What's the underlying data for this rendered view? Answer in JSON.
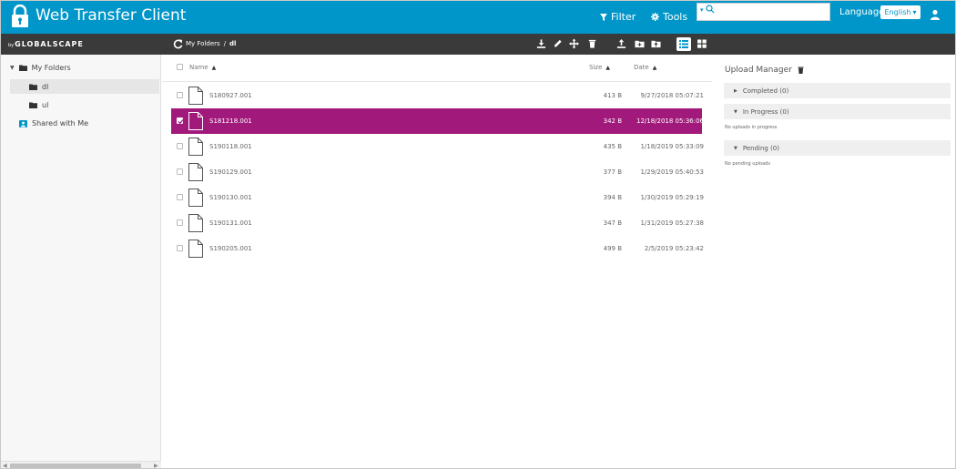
{
  "header": {
    "title": "Web Transfer Client",
    "filter_label": "Filter",
    "tools_label": "Tools",
    "search_placeholder": "",
    "language_label": "Language:",
    "language_value": "English"
  },
  "toolbar": {
    "brand_by": "by",
    "brand": "GLOBALSCAPE",
    "breadcrumb": [
      "My Folders",
      "/",
      "dl"
    ]
  },
  "sidebar": {
    "items": [
      {
        "label": "My Folders",
        "icon": "folder-icon",
        "expanded": true
      },
      {
        "label": "dl",
        "icon": "folder-icon",
        "selected": true
      },
      {
        "label": "ul",
        "icon": "folder-icon"
      },
      {
        "label": "Shared with Me",
        "icon": "shared-icon"
      }
    ]
  },
  "files": {
    "columns": {
      "name": "Name",
      "size": "Size",
      "date": "Date"
    },
    "rows": [
      {
        "name": "S180927.001",
        "size": "413 B",
        "date": "9/27/2018 05:07:21",
        "selected": false
      },
      {
        "name": "S181218.001",
        "size": "342 B",
        "date": "12/18/2018 05:36:06",
        "selected": true
      },
      {
        "name": "S190118.001",
        "size": "435 B",
        "date": "1/18/2019 05:33:09",
        "selected": false
      },
      {
        "name": "S190129.001",
        "size": "377 B",
        "date": "1/29/2019 05:40:53",
        "selected": false
      },
      {
        "name": "S190130.001",
        "size": "394 B",
        "date": "1/30/2019 05:29:19",
        "selected": false
      },
      {
        "name": "S190131.001",
        "size": "347 B",
        "date": "1/31/2019 05:27:38",
        "selected": false
      },
      {
        "name": "S190205.001",
        "size": "499 B",
        "date": "2/5/2019 05:23:42",
        "selected": false
      }
    ]
  },
  "upload_manager": {
    "title": "Upload Manager",
    "completed": "Completed (0)",
    "in_progress": "In Progress (0)",
    "in_progress_note": "No uploads in progress",
    "pending": "Pending (0)",
    "pending_note": "No pending uploads"
  },
  "colors": {
    "header_bg": "#0096c9",
    "toolbar_bg": "#3a3a3a",
    "selection": "#a2197c"
  }
}
